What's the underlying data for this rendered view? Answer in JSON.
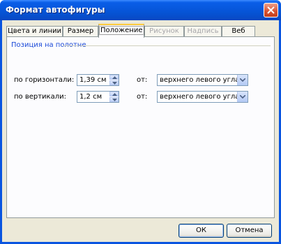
{
  "window": {
    "title": "Формат автофигуры"
  },
  "tabs": [
    {
      "label": "Цвета и линии",
      "state": "normal"
    },
    {
      "label": "Размер",
      "state": "normal"
    },
    {
      "label": "Положение",
      "state": "active"
    },
    {
      "label": "Рисунок",
      "state": "disabled"
    },
    {
      "label": "Надпись",
      "state": "disabled"
    },
    {
      "label": "Веб",
      "state": "normal"
    }
  ],
  "position_group": {
    "title": "Позиция на полотне",
    "horizontal": {
      "label": "по горизонтали:",
      "value": "1,39 см",
      "from_label": "от:",
      "from_value": "верхнего левого угла"
    },
    "vertical": {
      "label": "по вертикали:",
      "value": "1,2 см",
      "from_label": "от:",
      "from_value": "верхнего левого угла"
    }
  },
  "buttons": {
    "ok": "ОК",
    "cancel": "Отмена"
  },
  "colors": {
    "title_bar": "#0a55e0",
    "client_bg": "#ece9d8",
    "group_title": "#1c4ad8",
    "active_tab_accent": "#ffc83c"
  }
}
